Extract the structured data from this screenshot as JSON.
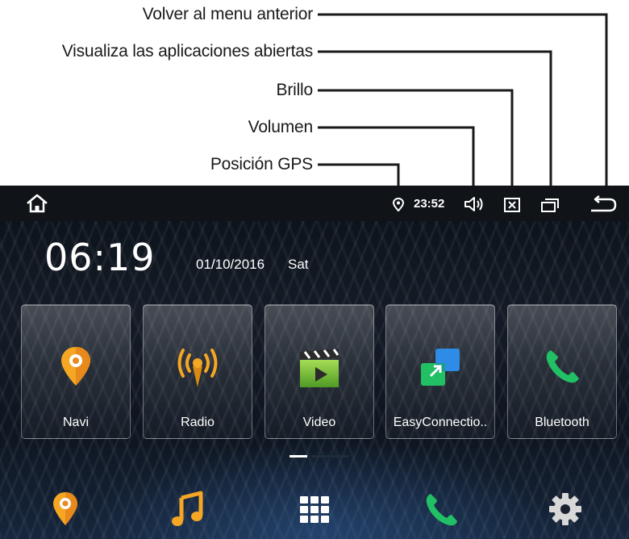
{
  "annotations": [
    {
      "id": "back",
      "label": "Volver al menu anterior"
    },
    {
      "id": "recent",
      "label": "Visualiza las aplicaciones abiertas"
    },
    {
      "id": "brightness",
      "label": "Brillo"
    },
    {
      "id": "volume",
      "label": "Volumen"
    },
    {
      "id": "gps",
      "label": "Posición GPS"
    }
  ],
  "status_bar": {
    "time": "23:52",
    "icons": [
      "home-icon",
      "location-pin-icon",
      "speaker-icon",
      "brightness-box-icon",
      "recent-apps-icon",
      "back-arrow-icon"
    ]
  },
  "clock": {
    "time": "06:19",
    "date": "01/10/2016",
    "day": "Sat"
  },
  "apps": [
    {
      "label": "Navi",
      "icon": "map-pin-icon"
    },
    {
      "label": "Radio",
      "icon": "radio-antenna-icon"
    },
    {
      "label": "Video",
      "icon": "video-clapper-icon"
    },
    {
      "label": "EasyConnectio..",
      "icon": "easyconnection-icon"
    },
    {
      "label": "Bluetooth",
      "icon": "phone-icon"
    }
  ],
  "pager": {
    "pages": 3,
    "active": 1
  },
  "dock": [
    "map-pin-icon",
    "music-note-icon",
    "app-grid-icon",
    "phone-icon",
    "settings-gear-icon"
  ],
  "colors": {
    "accent_orange": "#f5a623",
    "accent_green": "#21c064",
    "accent_blue": "#2e8be6",
    "status_bg": "#101418"
  }
}
